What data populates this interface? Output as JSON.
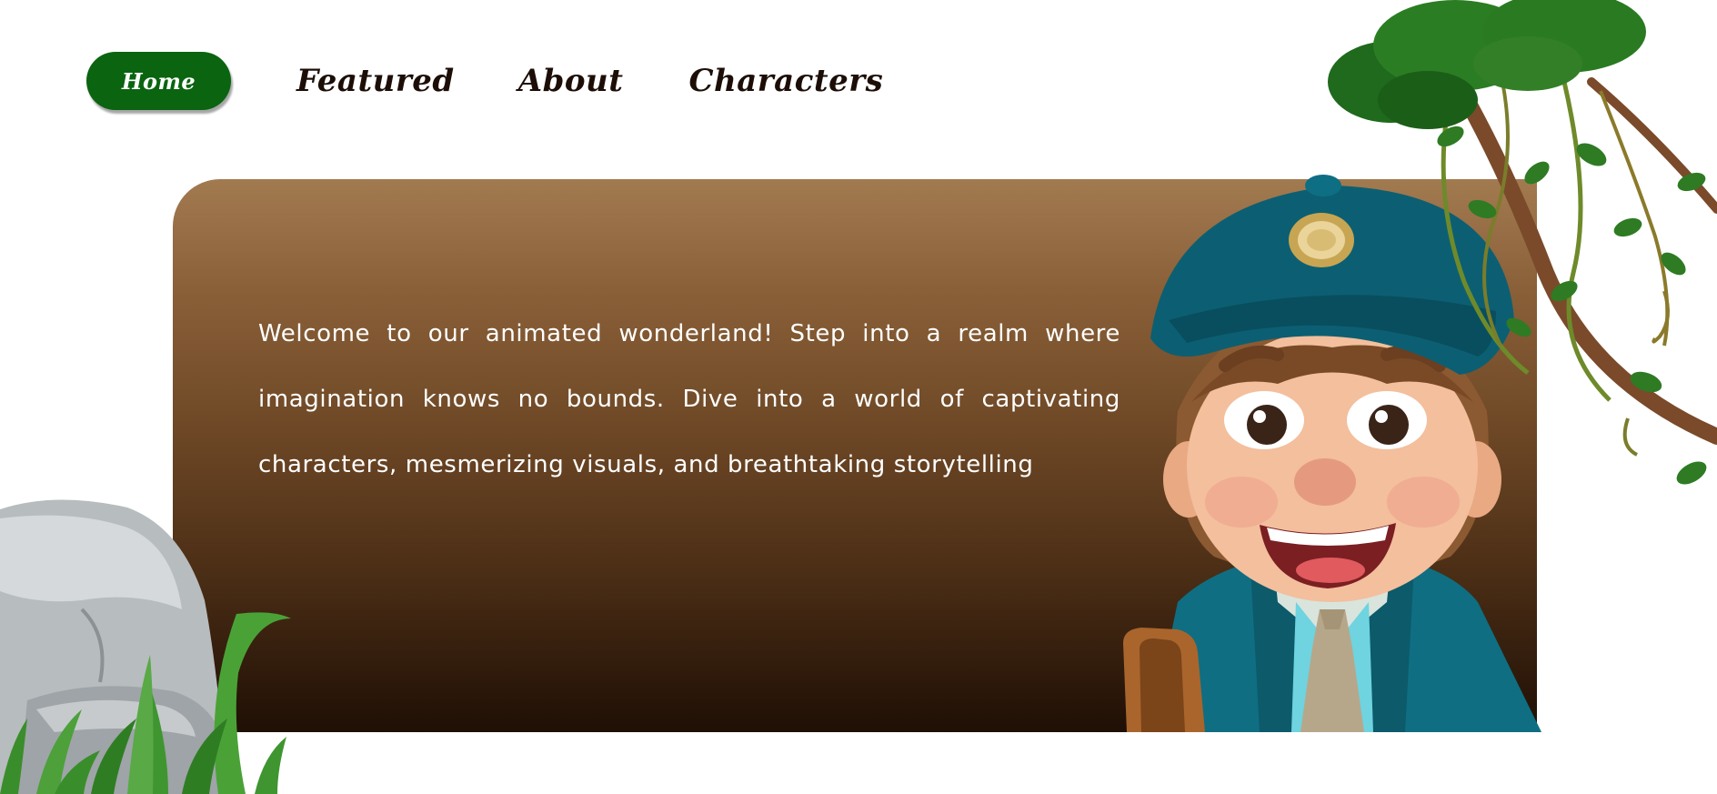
{
  "nav": {
    "home_label": "Home",
    "featured_label": "Featured",
    "about_label": "About",
    "characters_label": "Characters"
  },
  "hero": {
    "intro_text": "Welcome to our animated wonderland! Step into a realm where imagination knows no bounds. Dive into a world of captivating characters, mesmerizing visuals, and breathtaking storytelling"
  },
  "icons": {
    "character_illustration": "cartoon-boy-in-cap-illustration",
    "vines": "jungle-vines-decoration",
    "rock": "rock-with-grass-decoration"
  },
  "colors": {
    "home_button": "#0a6410",
    "nav_text": "#1c0e07",
    "hero_top": "#a27a50",
    "hero_bottom": "#1f0f05",
    "hero_text": "#ffffff"
  }
}
